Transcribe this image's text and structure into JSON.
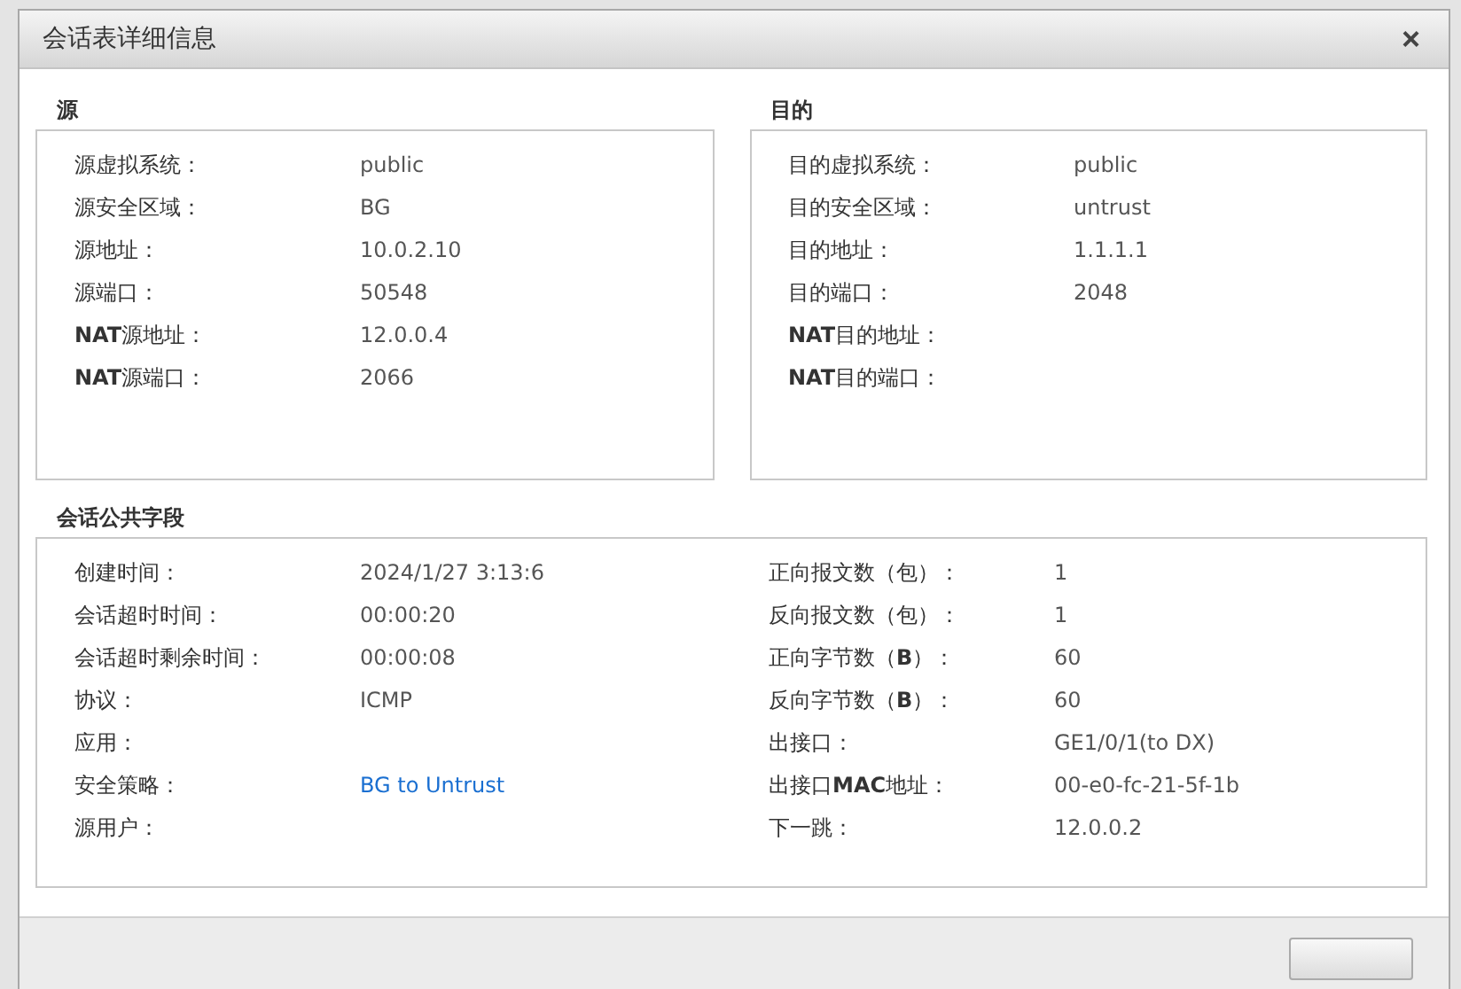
{
  "dialog": {
    "title": "会话表详细信息",
    "close": "×"
  },
  "source": {
    "title": "源",
    "fields": [
      {
        "label": "源虚拟系统：",
        "value": "public",
        "kind": "text"
      },
      {
        "label": "源安全区域：",
        "value": "BG",
        "kind": "text"
      },
      {
        "label": "源地址：",
        "value": "10.0.2.10",
        "kind": "text"
      },
      {
        "label": "源端口：",
        "value": "50548",
        "kind": "text"
      },
      {
        "label": "**NAT**源地址：",
        "value": "12.0.0.4",
        "kind": "text"
      },
      {
        "label": "**NAT**源端口：",
        "value": "2066",
        "kind": "text"
      }
    ]
  },
  "destination": {
    "title": "目的",
    "fields": [
      {
        "label": "目的虚拟系统：",
        "value": "public",
        "kind": "text"
      },
      {
        "label": "目的安全区域：",
        "value": "untrust",
        "kind": "text"
      },
      {
        "label": "目的地址：",
        "value": "1.1.1.1",
        "kind": "text"
      },
      {
        "label": "目的端口：",
        "value": "2048",
        "kind": "text"
      },
      {
        "label": "**NAT**目的地址："
      },
      {
        "label": "**NAT**目的端口："
      }
    ]
  },
  "common": {
    "title": "会话公共字段",
    "left_fields": [
      {
        "label": "创建时间：",
        "value": "2024/1/27 3:13:6",
        "kind": "text"
      },
      {
        "label": "会话超时时间：",
        "value": "00:00:20",
        "kind": "text"
      },
      {
        "label": "会话超时剩余时间：",
        "value": "00:00:08",
        "kind": "text"
      },
      {
        "label": "协议：",
        "value": "ICMP",
        "kind": "text"
      },
      {
        "label": "应用："
      },
      {
        "label": "安全策略：",
        "value": "BG to Untrust",
        "kind": "link"
      },
      {
        "label": "源用户："
      }
    ],
    "right_fields": [
      {
        "label": "正向报文数（包）：",
        "value": "1",
        "kind": "text"
      },
      {
        "label": "反向报文数（包）：",
        "value": "1",
        "kind": "text"
      },
      {
        "label": "正向字节数（**B**）：",
        "value": "60",
        "kind": "text"
      },
      {
        "label": "反向字节数（**B**）：",
        "value": "60",
        "kind": "text"
      },
      {
        "label": "出接口：",
        "value": "GE1/0/1(to DX)",
        "kind": "text"
      },
      {
        "label": "出接口**MAC**地址：",
        "value": "00-e0-fc-21-5f-1b",
        "kind": "text"
      },
      {
        "label": "下一跳：",
        "value": "12.0.0.2",
        "kind": "text"
      }
    ]
  }
}
